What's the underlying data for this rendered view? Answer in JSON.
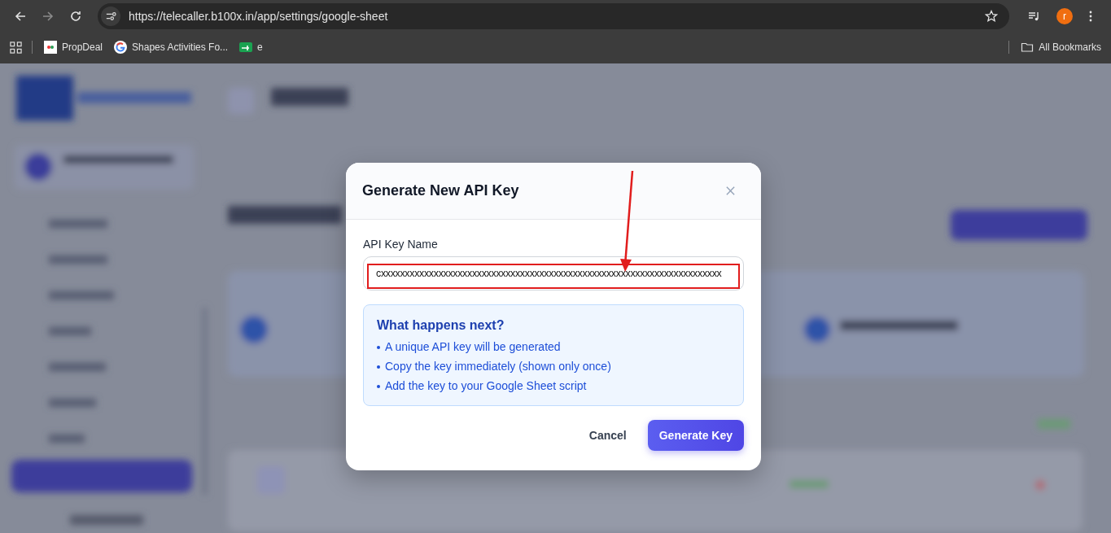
{
  "browser": {
    "url": "https://telecaller.b100x.in/app/settings/google-sheet",
    "profile_initial": "r",
    "bookmarks": [
      {
        "label": "PropDeal",
        "kind": "pd"
      },
      {
        "label": "Shapes Activities Fo...",
        "kind": "google"
      },
      {
        "label": "e",
        "kind": "green"
      }
    ],
    "all_bookmarks": "All Bookmarks"
  },
  "dialog": {
    "title": "Generate New API Key",
    "field_label": "API Key Name",
    "field_value": "cxxxxxxxxxxxxxxxxxxxxxxxxxxxxxxxxxxxxxxxxxxxxxxxxxxxxxxxxxxxxxxxxxxxxxxx",
    "info_title": "What happens next?",
    "info_items": [
      "A unique API key will be generated",
      "Copy the key immediately (shown only once)",
      "Add the key to your Google Sheet script"
    ],
    "buttons": [
      {
        "label": "Cancel",
        "kind": "secondary"
      },
      {
        "label": "Generate Key",
        "kind": "primary"
      }
    ]
  }
}
